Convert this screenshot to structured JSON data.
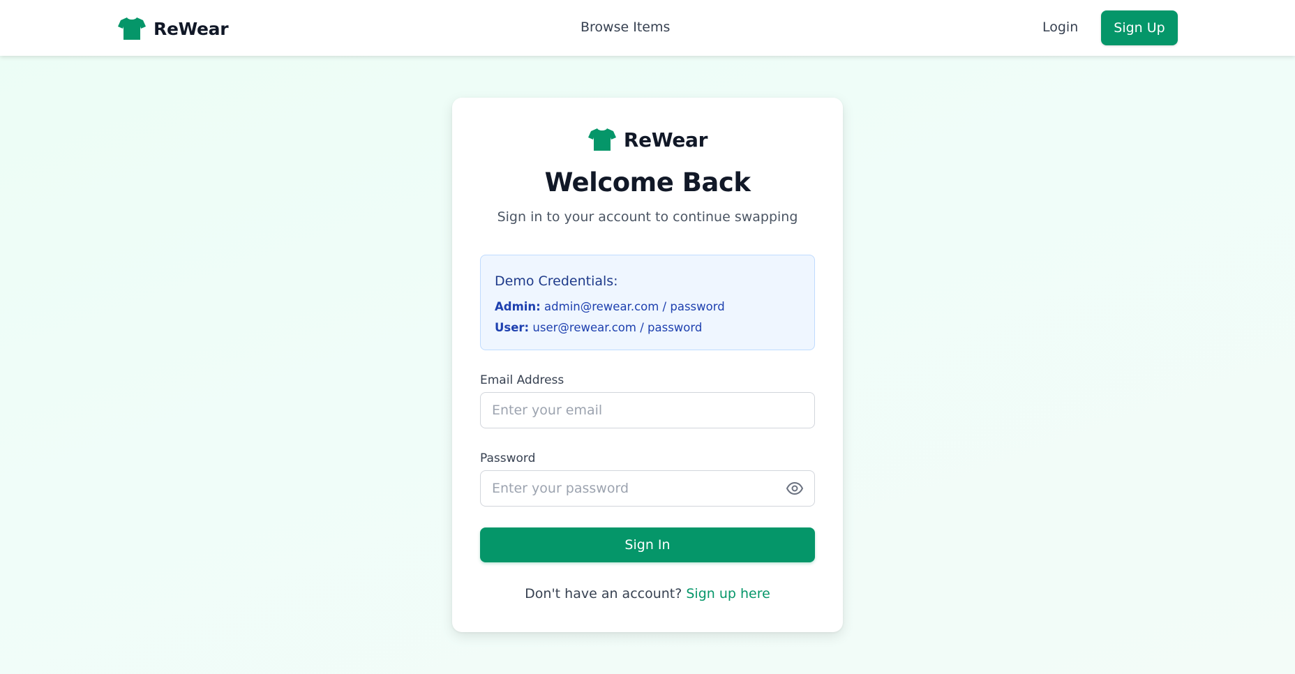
{
  "colors": {
    "brand": "#059669",
    "text_primary": "#111827",
    "info_bg": "#eff6ff",
    "info_text": "#1e40af"
  },
  "navbar": {
    "brand_name": "ReWear",
    "brand_icon": "tshirt-icon",
    "browse_label": "Browse Items",
    "login_label": "Login",
    "signup_label": "Sign Up"
  },
  "card": {
    "brand_name": "ReWear",
    "brand_icon": "tshirt-icon",
    "title": "Welcome Back",
    "subtitle": "Sign in to your account to continue swapping",
    "demo": {
      "title": "Demo Credentials:",
      "admin_label": "Admin:",
      "admin_value": "admin@rewear.com / password",
      "user_label": "User:",
      "user_value": "user@rewear.com / password"
    },
    "email": {
      "label": "Email Address",
      "placeholder": "Enter your email",
      "value": ""
    },
    "password": {
      "label": "Password",
      "placeholder": "Enter your password",
      "value": "",
      "toggle_icon": "eye-icon"
    },
    "submit_label": "Sign In",
    "footer_prompt": "Don't have an account?",
    "footer_link": "Sign up here"
  }
}
